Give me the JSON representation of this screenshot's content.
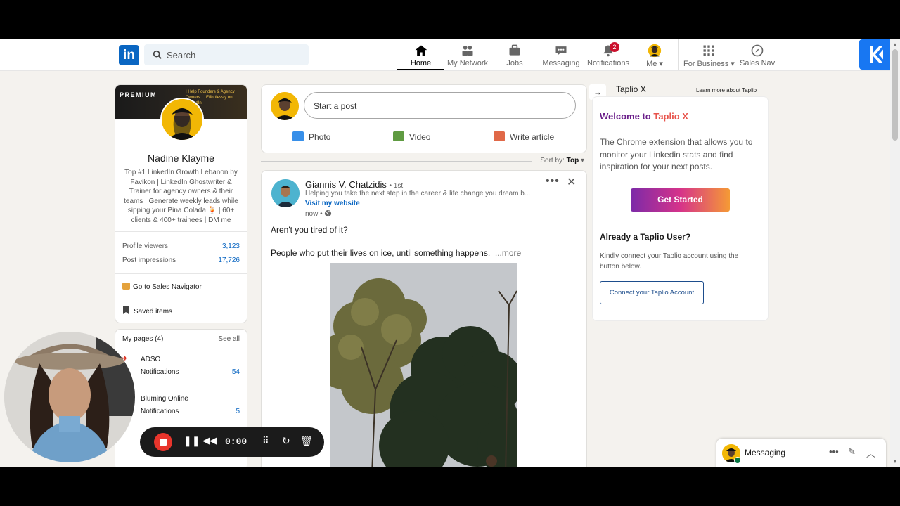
{
  "nav": {
    "search_placeholder": "Search",
    "items": [
      {
        "label": "Home",
        "icon": "home-icon"
      },
      {
        "label": "My Network",
        "icon": "people-icon"
      },
      {
        "label": "Jobs",
        "icon": "briefcase-icon"
      },
      {
        "label": "Messaging",
        "icon": "chat-icon"
      },
      {
        "label": "Notifications",
        "icon": "bell-icon",
        "badge": "2"
      },
      {
        "label": "Me",
        "icon": "avatar"
      },
      {
        "label": "For Business",
        "icon": "grid-icon"
      },
      {
        "label": "Sales Nav",
        "icon": "compass-icon"
      }
    ]
  },
  "profile": {
    "banner_label": "PREMIUM",
    "banner_tagline": "I Help Founders & Agency Owners ... Effortlessly on LinkedIn",
    "name": "Nadine Klayme",
    "headline": "Top #1 LinkedIn Growth Lebanon by Favikon | LinkedIn Ghostwriter & Trainer for agency owners & their teams | Generate weekly leads while sipping your Pina Colada 🍹 | 60+ clients & 400+ trainees | DM me",
    "stats": [
      {
        "label": "Profile viewers",
        "value": "3,123"
      },
      {
        "label": "Post impressions",
        "value": "17,726"
      }
    ],
    "sales_nav": "Go to Sales Navigator",
    "saved": "Saved items"
  },
  "pages": {
    "title": "My pages (4)",
    "see_all": "See all",
    "items": [
      {
        "name": "ADSO",
        "sub": "Notifications",
        "count": "54"
      },
      {
        "name": "Bluming Online",
        "sub": "Notifications",
        "count": "5"
      }
    ]
  },
  "composer": {
    "placeholder": "Start a post",
    "actions": [
      {
        "label": "Photo",
        "color": "#378fe9"
      },
      {
        "label": "Video",
        "color": "#5f9b41"
      },
      {
        "label": "Write article",
        "color": "#e06847"
      }
    ]
  },
  "sort": {
    "label": "Sort by:",
    "value": "Top"
  },
  "post": {
    "author": "Giannis V. Chatzidis",
    "degree": "• 1st",
    "headline": "Helping you take the next step in the career & life change you dream b...",
    "visit": "Visit my website",
    "time": "now •",
    "line1": "Aren't you tired of it?",
    "line2": "People who put their lives on ice, until something happens.",
    "more": "...more"
  },
  "taplio": {
    "title": "Taplio X",
    "learn_more": "Learn more about Taplio",
    "welcome": "Welcome to ",
    "brand": "Taplio X",
    "description": "The Chrome extension that allows you to monitor your Linkedin stats and find inspiration for your next posts.",
    "cta": "Get Started",
    "already": "Already a Taplio User?",
    "kindly": "Kindly connect your Taplio account using the button below.",
    "connect": "Connect your Taplio Account"
  },
  "messaging": {
    "label": "Messaging"
  },
  "recorder": {
    "time": "0:00"
  },
  "colors": {
    "linkedin_blue": "#0a66c2",
    "taplio_purple": "#6b1f8a",
    "record_red": "#e8352c"
  }
}
